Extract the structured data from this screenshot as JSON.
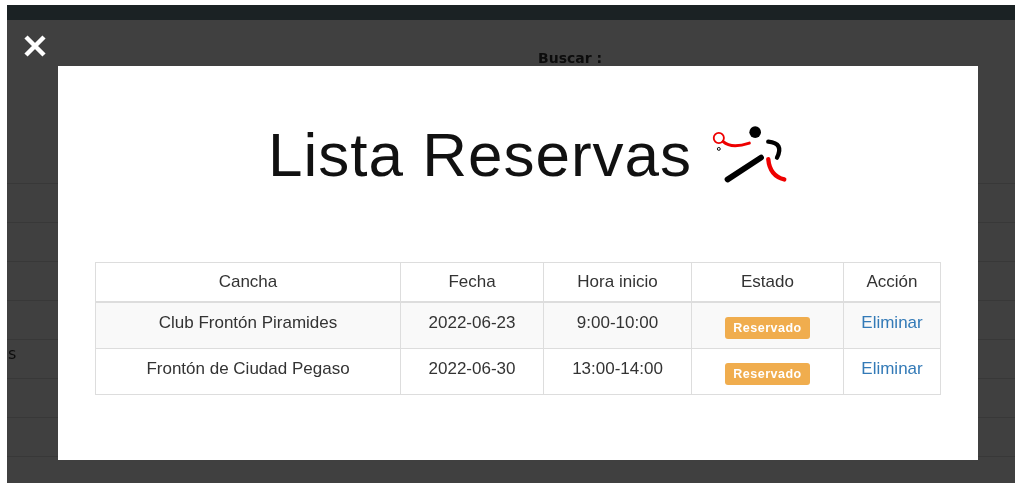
{
  "background": {
    "search_label": "Buscar :",
    "partial_text": "s"
  },
  "modal": {
    "title": "Lista Reservas",
    "table": {
      "columns": [
        "Cancha",
        "Fecha",
        "Hora inicio",
        "Estado",
        "Acción"
      ],
      "rows": [
        {
          "court": "Club Frontón Piramides",
          "date": "2022-06-23",
          "time": "9:00-10:00",
          "status": "Reservado",
          "action": "Eliminar"
        },
        {
          "court": "Frontón de Ciudad Pegaso",
          "date": "2022-06-30",
          "time": "13:00-14:00",
          "status": "Reservado",
          "action": "Eliminar"
        }
      ]
    }
  }
}
